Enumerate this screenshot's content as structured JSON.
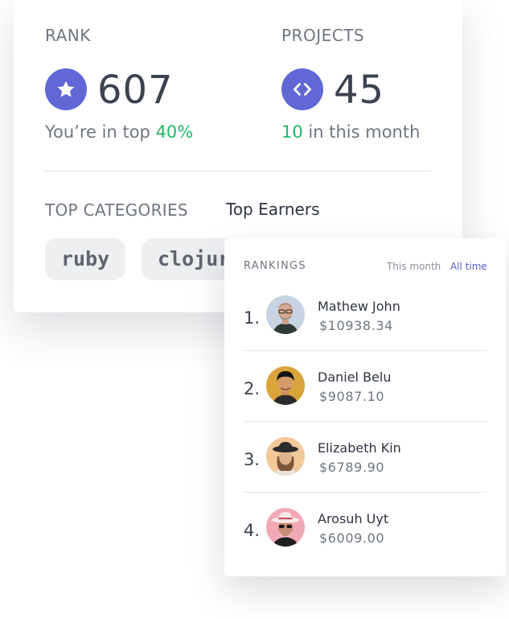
{
  "stats": {
    "rank": {
      "label": "RANK",
      "value": "607",
      "sub_prefix": "You’re in top",
      "sub_highlight": "40%",
      "icon": "star-icon"
    },
    "projects": {
      "label": "PROJECTS",
      "value": "45",
      "sub_highlight": "10",
      "sub_suffix": "in this month",
      "icon": "code-icon"
    }
  },
  "sections": {
    "categories_label": "TOP CATEGORIES",
    "earners_tab": "Top Earners"
  },
  "categories": [
    "ruby",
    "clojure"
  ],
  "rankings": {
    "title": "RANKINGS",
    "filters": {
      "this_month": "This month",
      "all_time": "All time",
      "active": "All time"
    },
    "items": [
      {
        "rank": "1.",
        "name": "Mathew John",
        "amount": "$10938.34"
      },
      {
        "rank": "2.",
        "name": "Daniel Belu",
        "amount": "$9087.10"
      },
      {
        "rank": "3.",
        "name": "Elizabeth Kin",
        "amount": "$6789.90"
      },
      {
        "rank": "4.",
        "name": "Arosuh Uyt",
        "amount": "$6009.00"
      }
    ]
  },
  "colors": {
    "accent": "#6168d6",
    "positive": "#1fb86a",
    "link": "#5860d2"
  }
}
